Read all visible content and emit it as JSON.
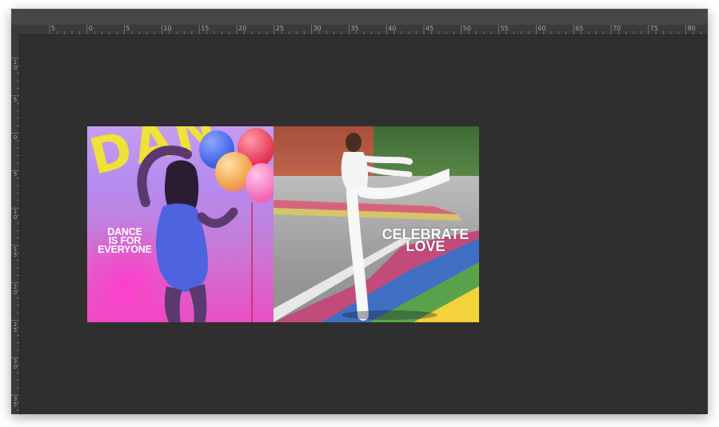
{
  "ruler": {
    "top_labels": [
      "5",
      "0",
      "5",
      "10",
      "15",
      "20",
      "25",
      "30",
      "35",
      "40",
      "45",
      "50",
      "55",
      "60",
      "65",
      "70",
      "75",
      "80"
    ],
    "left_labels": [
      "10",
      "5",
      "0",
      "5",
      "10",
      "15",
      "20",
      "25",
      "30",
      "35"
    ]
  },
  "artwork": {
    "left_panel": {
      "background_text": "DAN",
      "caption_lines": [
        "DANCE",
        "IS FOR",
        "EVERYONE"
      ]
    },
    "right_panel": {
      "caption_lines": [
        "CELEBRATE",
        "LOVE"
      ]
    }
  },
  "colors": {
    "workspace": "#2f2f2f",
    "ruler": "#3a3a3a",
    "accent_yellow": "#f2e62f",
    "rainbow": [
      "#e23b3b",
      "#f08a2a",
      "#f2d43a",
      "#5aa34a",
      "#3f6fc4",
      "#8a4fb0"
    ]
  }
}
